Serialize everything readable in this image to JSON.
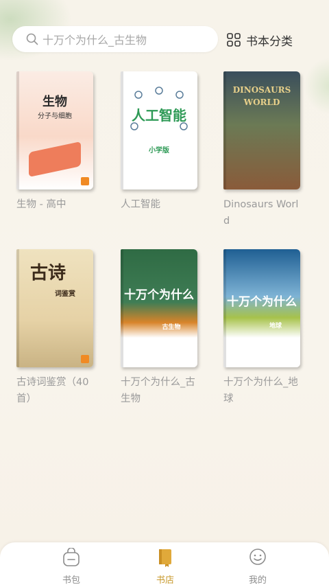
{
  "search": {
    "placeholder": "十万个为什么_古生物"
  },
  "category": {
    "label": "书本分类"
  },
  "books": [
    {
      "title": "生物 - 高中",
      "cover_text": "生物",
      "cover_sub": "分子与细胞"
    },
    {
      "title": "人工智能",
      "cover_text": "人工智能",
      "cover_sub": "小学版"
    },
    {
      "title": "Dinosaurs World",
      "cover_text": "DINOSAURS WORLD"
    },
    {
      "title": "古诗词鉴赏（40首）",
      "cover_text": "古诗",
      "cover_sub": "词鉴赏"
    },
    {
      "title": "十万个为什么_古生物",
      "cover_text": "十万个为什么",
      "cover_sub": "古生物"
    },
    {
      "title": "十万个为什么_地球",
      "cover_text": "十万个为什么",
      "cover_sub": "地球"
    }
  ],
  "tabs": [
    {
      "label": "书包",
      "icon": "bag-icon",
      "active": false
    },
    {
      "label": "书店",
      "icon": "book-icon",
      "active": true
    },
    {
      "label": "我的",
      "icon": "profile-icon",
      "active": false
    }
  ],
  "colors": {
    "accent": "#c89a2e",
    "text_muted": "#9a9a9a"
  }
}
